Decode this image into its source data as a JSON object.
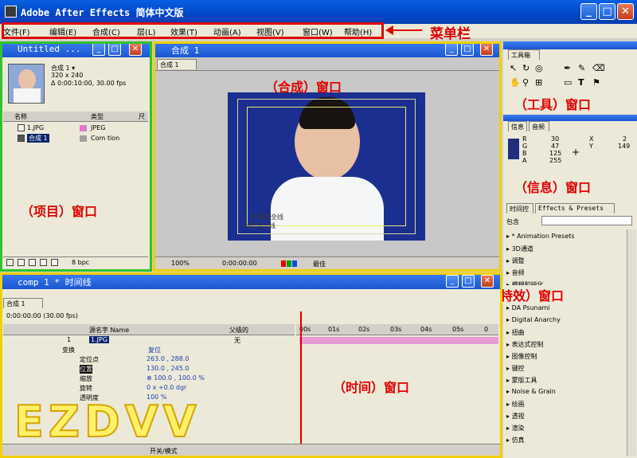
{
  "app": {
    "title": "Adobe After Effects 简体中文版"
  },
  "menu": {
    "items": [
      "文件(F)",
      "编辑(E)",
      "合成(C)",
      "层(L)",
      "效果(T)",
      "动画(A)",
      "视图(V)",
      "窗口(W)",
      "帮助(H)"
    ],
    "callout": "菜单栏"
  },
  "project": {
    "title": "Untitled ...",
    "comp_name": "合成 1 ▾",
    "comp_size": "320 x 240",
    "comp_duration": "Δ 0:00:10:00, 30.00 fps",
    "col_name": "名称",
    "col_type": "类型",
    "col_size": "尺",
    "rows": [
      {
        "name": "1.JPG",
        "type": "JPEG"
      },
      {
        "name": "合成 1",
        "type": "Com    tion"
      }
    ],
    "bpc": "8 bpc",
    "callout": "（项目）窗口"
  },
  "comp": {
    "title": "合成 1",
    "tab": "合成 1",
    "safe_title": "字幕安全线",
    "safe_action": "动作安全线",
    "zoom": "100%",
    "timecode": "0:00:00:00",
    "quality": "最佳",
    "callout": "（合成）窗口"
  },
  "tools": {
    "tab": "工具箱",
    "callout": "（工具）窗口"
  },
  "info": {
    "tab_info": "信息",
    "tab_audio": "音频",
    "r_label": "R",
    "r_val": "30",
    "g_label": "G",
    "g_val": "47",
    "b_label": "B",
    "b_val": "125",
    "a_label": "A",
    "a_val": "255",
    "x_label": "X",
    "x_val": "2",
    "y_label": "Y",
    "y_val": "149",
    "swatch_color": "#1e2f7d",
    "callout": "（信息）窗口"
  },
  "effects": {
    "tab_timeline": "时间控",
    "tab_effects": "Effects & Presets",
    "contains_label": "包含",
    "items": [
      "* Animation Presets",
      "3D通道",
      "调整",
      "音频",
      "模糊和锐化",
      "通道",
      "DA Psunami",
      "Digital Anarchy",
      "扭曲",
      "表达式控制",
      "图像控制",
      "键控",
      "蒙版工具",
      "Noise & Grain",
      "绘画",
      "透视",
      "渲染",
      "仿真"
    ],
    "callout": "（特效）窗口"
  },
  "timeline": {
    "title": "comp 1 * 时间线",
    "tab": "合成 1",
    "timecode": "0:00:00:00 (30.00 fps)",
    "col_source": "源名字 Name",
    "col_parent": "父级的",
    "layer_num": "1",
    "layer_name": "1.JPG",
    "parent_value": "无",
    "transform_label": "变换",
    "reset_label": "复位",
    "props": [
      {
        "name": "定位点",
        "value": "263.0 , 288.0"
      },
      {
        "name": "位置",
        "value": "130.0 , 245.0"
      },
      {
        "name": "缩放",
        "value": "⊗ 100.0 , 100.0 %"
      },
      {
        "name": "旋转",
        "value": "0 x +0.0 dgr"
      },
      {
        "name": "透明度",
        "value": "100 %"
      }
    ],
    "ruler": [
      "00s",
      "01s",
      "02s",
      "03s",
      "04s",
      "05s",
      "0"
    ],
    "switch_mode": "开关/模式",
    "callout": "（时间）窗口"
  },
  "watermark": "EZDVV"
}
